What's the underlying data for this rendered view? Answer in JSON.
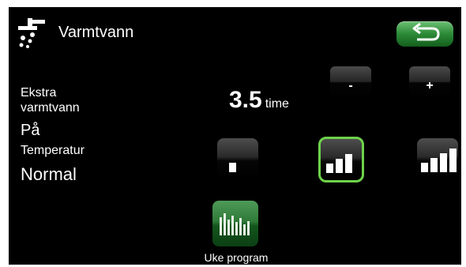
{
  "header": {
    "title": "Varmtvann",
    "icon": "tap-water-icon",
    "back_icon": "back-arrow-icon"
  },
  "extra_hot_water": {
    "label": "Ekstra varmtvann",
    "state": "På",
    "duration_value": "3.5",
    "duration_unit": "time",
    "decrease_label": "-",
    "increase_label": "+"
  },
  "temperature": {
    "label": "Temperatur",
    "value": "Normal",
    "levels": [
      {
        "icon": "temperature-level-low-icon",
        "selected": false
      },
      {
        "icon": "temperature-level-normal-icon",
        "selected": true
      },
      {
        "icon": "temperature-level-high-icon",
        "selected": false
      }
    ]
  },
  "week_program": {
    "label": "Uke program",
    "icon": "week-program-bars-icon"
  },
  "colors": {
    "background": "#000000",
    "accent_green": "#2c8a37",
    "selected_border": "#6ed24a",
    "text": "#ffffff"
  }
}
